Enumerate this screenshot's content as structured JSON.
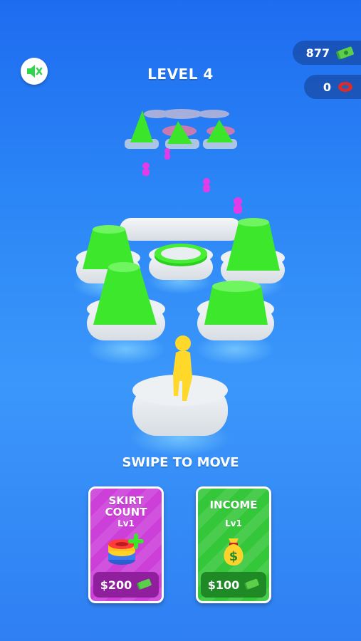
{
  "hud": {
    "level_label": "LEVEL 4",
    "money_value": "877",
    "rings_value": "0",
    "sound_icon": "speaker-muted-icon"
  },
  "hint": {
    "text": "SWIPE TO MOVE"
  },
  "upgrades": {
    "skirt": {
      "title_line1": "SKIRT",
      "title_line2": "COUNT",
      "level": "Lv1",
      "price": "$200",
      "icon": "skirt-ring-plus-icon"
    },
    "income": {
      "title": "INCOME",
      "level": "Lv1",
      "price": "$100",
      "icon": "money-bag-icon"
    }
  },
  "colors": {
    "background": "#2b86f6",
    "skirt_card": "#cc3fd9",
    "income_card": "#35c73a",
    "stack_green": "#3cf02a",
    "runner_yellow": "#ffd82a",
    "enemy_pink": "#e23ce8"
  }
}
